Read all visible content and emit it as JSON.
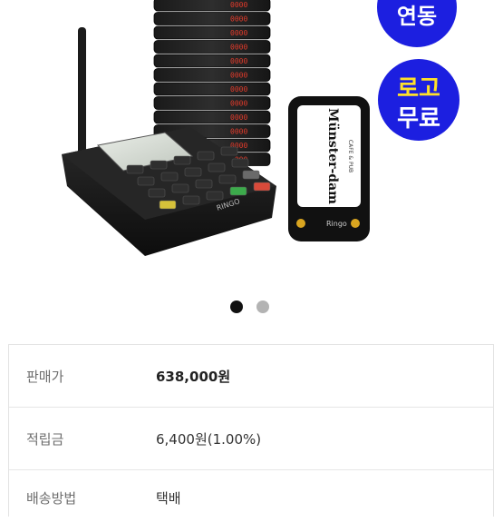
{
  "product_image": {
    "badges": [
      {
        "text": "연동"
      },
      {
        "line1": "로고",
        "line2": "무료"
      }
    ],
    "pager_brand": "Ringo",
    "receiver_logo_main": "Münster-dam",
    "receiver_logo_sub": "CAFE & PUB",
    "pager_displays": [
      "0000",
      "0000",
      "0000",
      "0000",
      "0000",
      "0000",
      "0000",
      "0000",
      "0000",
      "0000",
      "0000",
      "0000"
    ]
  },
  "carousel": {
    "total": 2,
    "active_index": 0
  },
  "product_info": {
    "rows": [
      {
        "label": "판매가",
        "value": "638,000원"
      },
      {
        "label": "적립금",
        "value": "6,400원(1.00%)"
      },
      {
        "label": "배송방법",
        "value": "택배"
      }
    ]
  },
  "colors": {
    "badge_blue": "#1c1fe0",
    "badge_yellow": "#ffe12a",
    "pager_led_red": "#e23a2a",
    "dot_active": "#111111",
    "dot_inactive": "#b3b3b3"
  }
}
